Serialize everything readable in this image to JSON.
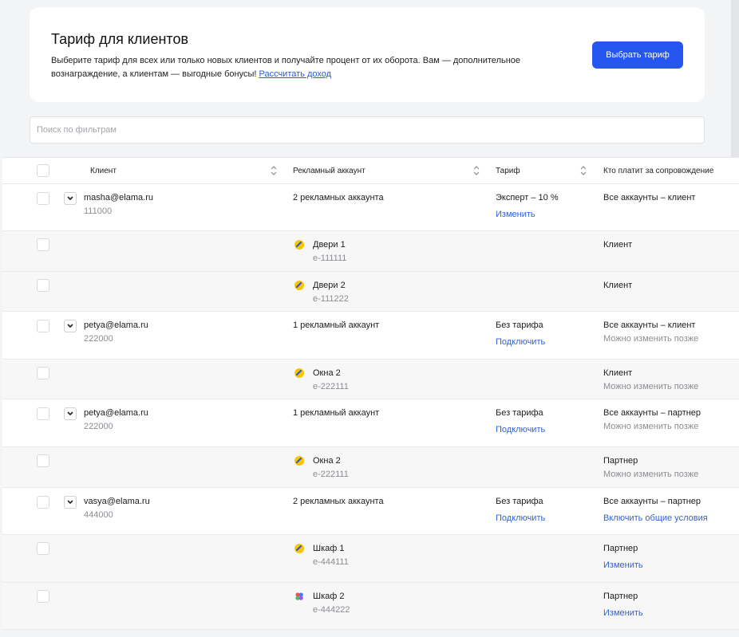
{
  "promo": {
    "title": "Тариф для клиентов",
    "desc_line1": "Выберите тариф для всех или только новых клиентов и получайте процент от их оборота. Вам — дополнительное",
    "desc_line2": "вознаграждение, а клиентам — выгодные бонусы! ",
    "desc_link": "Рассчитать доход",
    "button": "Выбрать тариф"
  },
  "search": {
    "placeholder": "Поиск по фильтрам"
  },
  "table": {
    "headers": {
      "client": "Клиент",
      "account": "Рекламный аккаунт",
      "tariff": "Тариф",
      "payer": "Кто платит за сопровождение"
    },
    "rows": [
      {
        "email": "masha@elama.ru",
        "id": "111000",
        "accounts": "2 рекламных аккаунта",
        "tariff": "Эксперт – 10 %",
        "tariff_action": "Изменить",
        "payer": "Все аккаунты – клиент",
        "payer_note": ""
      },
      {
        "acc_name": "Двери 1",
        "acc_id": "e-111111",
        "payer": "Клиент"
      },
      {
        "acc_name": "Двери 2",
        "acc_id": "e-111222",
        "payer": "Клиент"
      },
      {
        "email": "petya@elama.ru",
        "id": "222000",
        "accounts": "1 рекламный аккаунт",
        "tariff": "Без тарифа",
        "tariff_action": "Подключить",
        "payer": "Все аккаунты – клиент",
        "payer_note": "Можно изменить позже"
      },
      {
        "acc_name": "Окна 2",
        "acc_id": "e-222111",
        "payer": "Клиент",
        "payer_note": "Можно изменить позже"
      },
      {
        "email": "petya@elama.ru",
        "id": "222000",
        "accounts": "1 рекламный аккаунт",
        "tariff": "Без тарифа",
        "tariff_action": "Подключить",
        "payer": "Все аккаунты – партнер",
        "payer_note": "Можно изменить позже"
      },
      {
        "acc_name": "Окна 2",
        "acc_id": "e-222111",
        "payer": "Партнер",
        "payer_note": "Можно изменить позже"
      },
      {
        "email": "vasya@elama.ru",
        "id": "444000",
        "accounts": "2 рекламных аккаунта",
        "tariff": "Без тарифа",
        "tariff_action": "Подключить",
        "payer": "Все аккаунты – партнер",
        "payer_link": "Включить общие условия"
      },
      {
        "acc_name": "Шкаф 1",
        "acc_id": "e-444111",
        "payer": "Партнер",
        "payer_link": "Изменить"
      },
      {
        "acc_name": "Шкаф 2",
        "acc_id": "e-444222",
        "payer": "Партнер",
        "payer_link": "Изменить"
      }
    ]
  },
  "colors": {
    "accent": "#2557f0",
    "link": "#2f62e0",
    "yandex_yellow": "#f7c600",
    "yandex_blue": "#2f5bd8"
  }
}
